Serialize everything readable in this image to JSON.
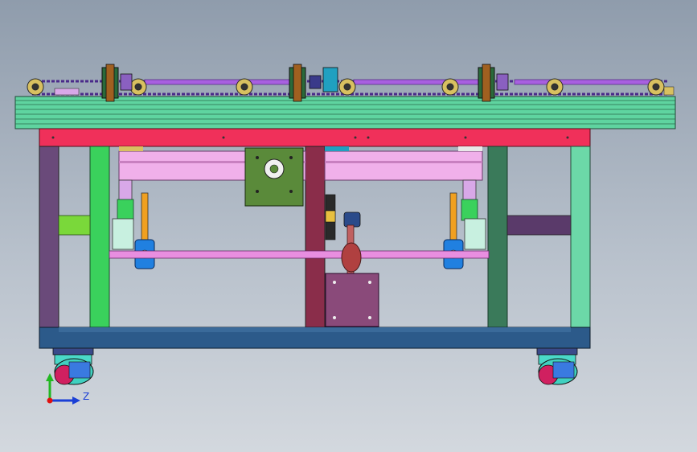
{
  "view": {
    "axis_triad": {
      "horizontal_label": "Z"
    }
  },
  "colors": {
    "background_top": "#8f9cac",
    "background_bottom": "#d3d8de",
    "top_plate": "#5fd4a0",
    "red_beam": "#f0305a",
    "bottom_beam": "#2c5a8a",
    "pink_rod": "#e88ee0",
    "purple_post": "#6a4a7a",
    "green_post": "#3ad15c",
    "center_post": "#8a2d4a",
    "gear_block": "#5a8a3a",
    "motor_plate": "#8a4a7a",
    "blue_bearing": "#2080e0",
    "chain": "#4a2a8a",
    "axis_x": "#1a3fd6",
    "axis_y": "#22b822",
    "axis_origin": "#e01010"
  }
}
